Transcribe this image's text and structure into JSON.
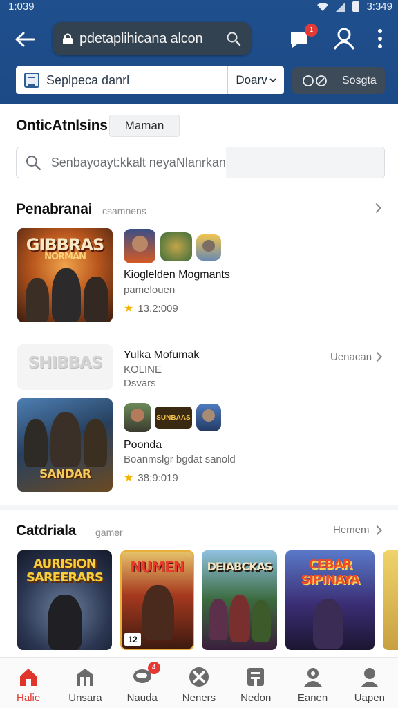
{
  "status_bar": {
    "time": "1:039",
    "clock_right": "3:349"
  },
  "header": {
    "url": "pdetaplihicana alcon",
    "message_badge": "1",
    "search_placeholder": "Seplpeca danrl",
    "dropdown_label": "Doarv",
    "filter_label": "Sosgta"
  },
  "main": {
    "section1": {
      "title": "OnticAtnlsins",
      "tag": "Maman"
    },
    "searchbox_placeholder": "Senbayoayt:kkalt neyaNlanrkan",
    "section2": {
      "title": "Penabranai",
      "sub": "csamnens"
    },
    "featured": [
      {
        "art_title": "GIBBRAS",
        "art_sub": "NORMAN",
        "name": "Kioglelden Mogmants",
        "dev": "pamelouen",
        "rating": "13,2:009"
      }
    ],
    "list_item2": {
      "art_title": "SHIBBAS",
      "name": "Yulka Mofumak",
      "line2": "KOLINE",
      "line3": "Dsvars",
      "action": "Uenacan"
    },
    "featured2": {
      "art_title": "SANDAR",
      "mini_label": "SUNBAAS",
      "name": "Poonda",
      "dev": "Boanmslgr bgdat sanold",
      "rating": "38:9:019"
    },
    "section3": {
      "title": "Catdriala",
      "sub": "gamer",
      "more": "Hemem"
    },
    "cards": [
      {
        "title": "AURISION SAREERARS",
        "badge": ""
      },
      {
        "title": "NUMEN",
        "badge": "12"
      },
      {
        "title": "DEIABCKAS",
        "badge": ""
      },
      {
        "title": "CEBAR SIPINAYA",
        "badge": ""
      }
    ]
  },
  "bottom_nav": {
    "items": [
      {
        "label": "Halie",
        "icon": "home-icon"
      },
      {
        "label": "Unsara",
        "icon": "store-icon"
      },
      {
        "label": "Nauda",
        "icon": "chat-icon",
        "badge": "4"
      },
      {
        "label": "Neners",
        "icon": "tools-icon"
      },
      {
        "label": "Nedon",
        "icon": "news-icon"
      },
      {
        "label": "Eanen",
        "icon": "friends-icon"
      },
      {
        "label": "Uapen",
        "icon": "profile-icon"
      }
    ]
  },
  "colors": {
    "header_bg": "#1f4f8d",
    "accent": "#e0352b",
    "badge": "#e53935",
    "star": "#f4b400"
  }
}
